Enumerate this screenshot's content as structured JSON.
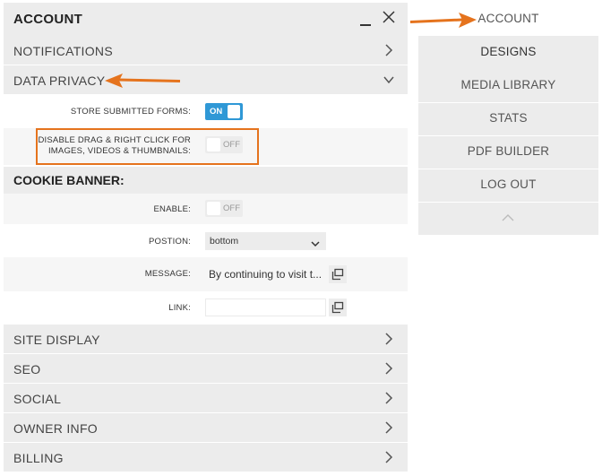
{
  "panel": {
    "title": "ACCOUNT",
    "sections": [
      {
        "label": "NOTIFICATIONS",
        "icon": "chevron-right-icon"
      },
      {
        "label": "DATA PRIVACY",
        "icon": "chevron-down-icon"
      }
    ],
    "data_privacy": {
      "store_label": "STORE SUBMITTED FORMS:",
      "store_state": "ON",
      "disable_label_line1": "DISABLE DRAG & RIGHT CLICK FOR",
      "disable_label_line2": "IMAGES, VIDEOS & THUMBNAILS:",
      "disable_state": "OFF"
    },
    "cookie_banner": {
      "title": "COOKIE BANNER:",
      "enable_label": "ENABLE:",
      "enable_state": "OFF",
      "position_label": "POSTION:",
      "position_value": "bottom",
      "message_label": "MESSAGE:",
      "message_value": "By continuing to visit t...",
      "link_label": "LINK:",
      "link_value": ""
    },
    "bottom_sections": [
      {
        "label": "SITE DISPLAY"
      },
      {
        "label": "SEO"
      },
      {
        "label": "SOCIAL"
      },
      {
        "label": "OWNER INFO"
      },
      {
        "label": "BILLING"
      }
    ]
  },
  "nav": {
    "items": [
      {
        "label": "ACCOUNT"
      },
      {
        "label": "DESIGNS"
      },
      {
        "label": "MEDIA LIBRARY"
      },
      {
        "label": "STATS"
      },
      {
        "label": "PDF BUILDER"
      },
      {
        "label": "LOG OUT"
      }
    ],
    "collapse_icon": "chevron-up-icon"
  },
  "colors": {
    "accent": "#2f98d6",
    "annotation": "#e5731d",
    "panel_bg": "#ececec"
  }
}
